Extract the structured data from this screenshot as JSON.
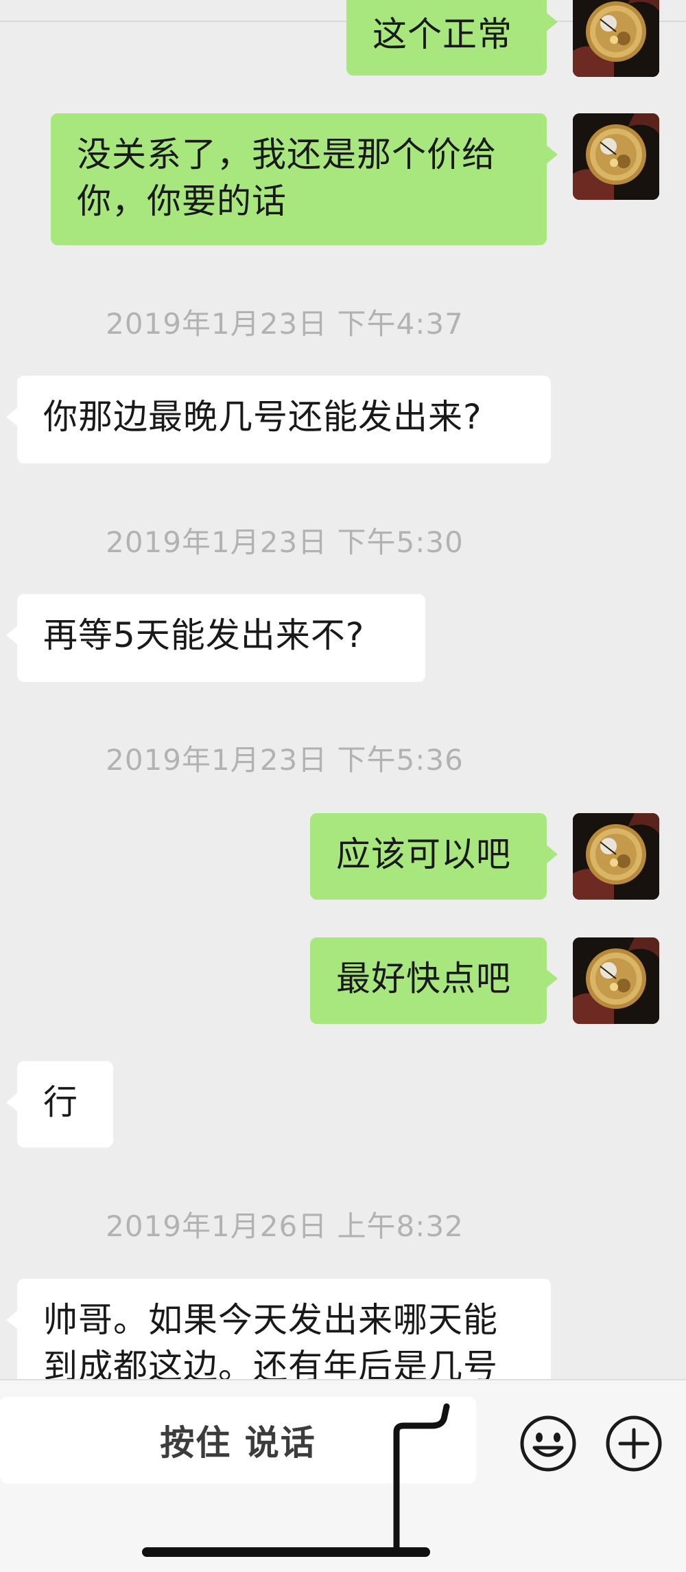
{
  "messages": {
    "m1": "这个正常",
    "m2": "没关系了，我还是那个价给你，你要的话",
    "ts1": "2019年1月23日 下午4:37",
    "m3": "你那边最晚几号还能发出来?",
    "ts2": "2019年1月23日 下午5:30",
    "m4": "再等5天能发出来不?",
    "ts3": "2019年1月23日 下午5:36",
    "m5": "应该可以吧",
    "m6": "最好快点吧",
    "m7": "行",
    "ts4": "2019年1月26日 上午8:32",
    "m8": "帅哥。如果今天发出来哪天能到成都这边。还有年后是几号"
  },
  "input_bar": {
    "voice_label": "按住 说话",
    "emoji_icon": "emoji-icon",
    "plus_icon": "plus-icon"
  },
  "colors": {
    "outgoing_bubble": "#a8e77e",
    "incoming_bubble": "#ffffff",
    "background": "#ededed",
    "timestamp": "#b2b2b2"
  }
}
